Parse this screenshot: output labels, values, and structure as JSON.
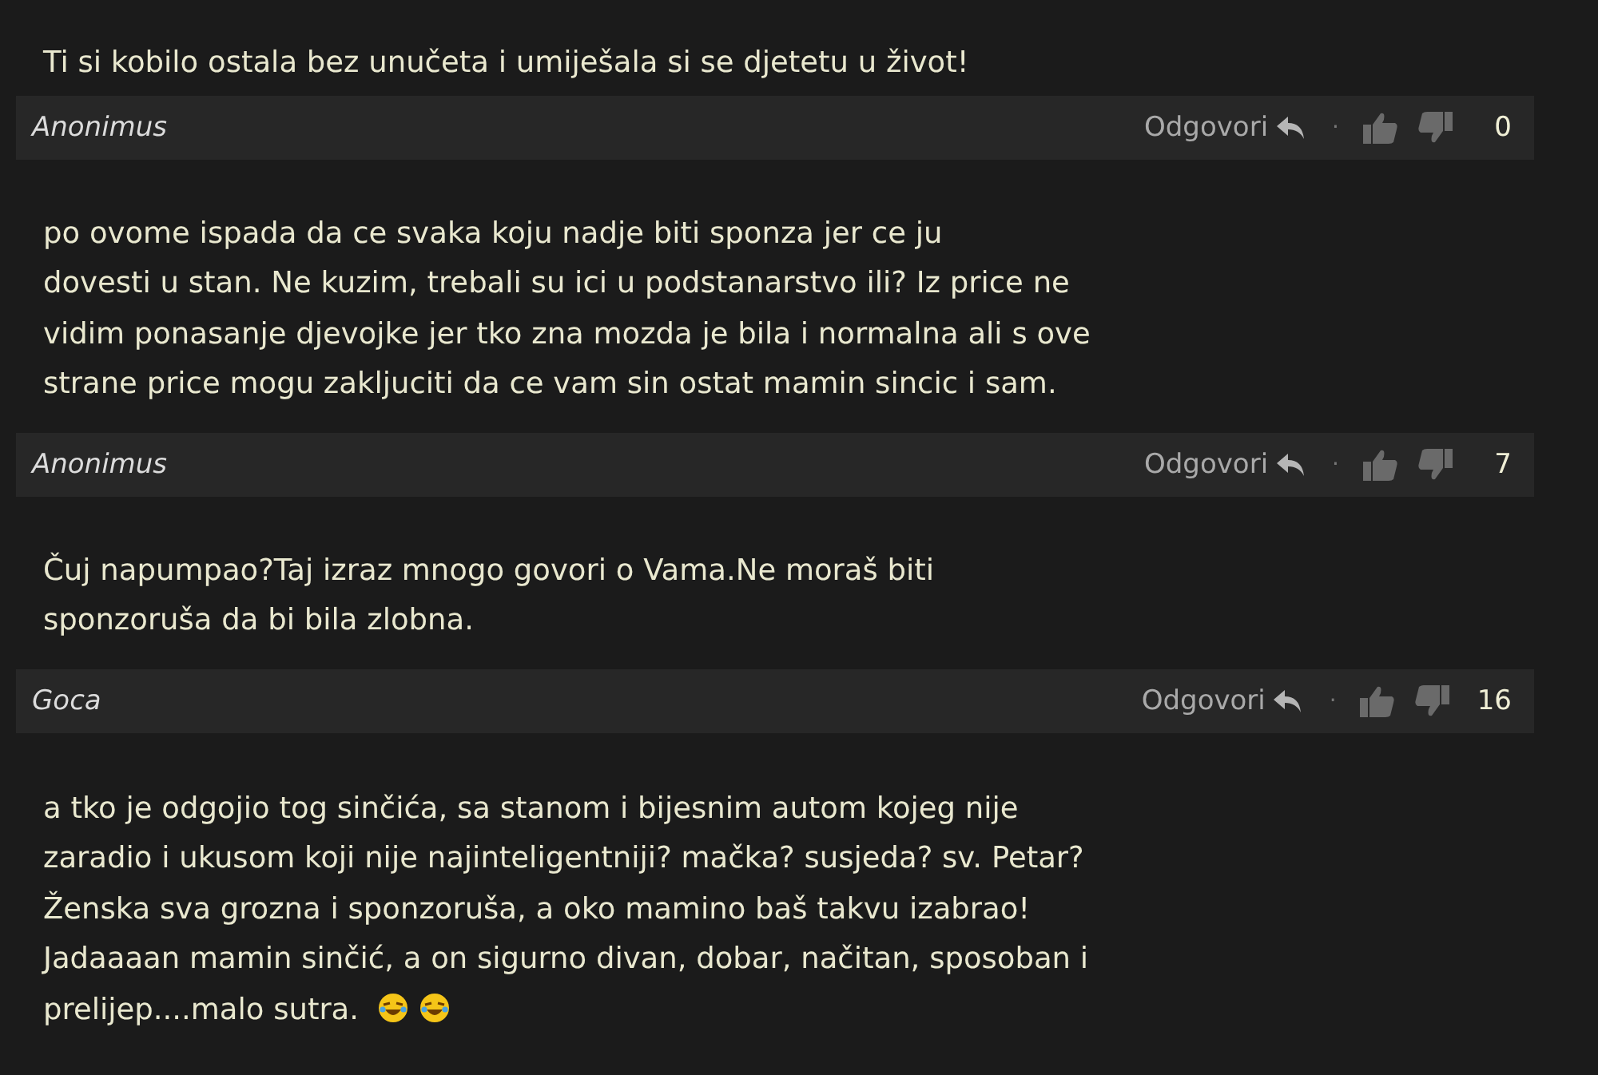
{
  "top_comment": {
    "lines": [
      "Ti si kobilo ostala bez unučeta i umiješala si se djetetu u život!"
    ]
  },
  "comments": [
    {
      "author": "Anonimus",
      "reply": "Odgovori",
      "separator": "·",
      "score": "0",
      "lines": [
        "po ovome ispada da ce svaka koju nadje biti sponza jer ce ju",
        "dovesti u stan. Ne kuzim, trebali su ici u podstanarstvo ili? Iz price ne",
        "vidim ponasanje djevojke jer tko zna mozda je bila i normalna ali s ove",
        "strane price mogu zakljuciti da ce vam sin ostat mamin sincic i sam."
      ]
    },
    {
      "author": "Anonimus",
      "reply": "Odgovori",
      "separator": "·",
      "score": "7",
      "lines": [
        "Čuj napumpao?Taj izraz mnogo govori o Vama.Ne moraš biti",
        "sponzoruša da bi bila zlobna."
      ]
    },
    {
      "author": "Goca",
      "reply": "Odgovori",
      "separator": "·",
      "score": "16",
      "lines": [
        "a tko je odgojio tog sinčića, sa stanom i bijesnim autom kojeg nije",
        "zaradio i ukusom koji nije najinteligentniji? mačka? susjeda? sv. Petar?",
        "Ženska sva grozna i sponzoruša, a oko mamino baš takvu izabrao!",
        "Jadaaaan mamin sinčić, a on sigurno divan, dobar, načitan, sposoban i",
        "prelijep....malo sutra."
      ],
      "emojis": [
        {
          "kind": "laughing"
        },
        {
          "kind": "laughing"
        }
      ]
    }
  ]
}
